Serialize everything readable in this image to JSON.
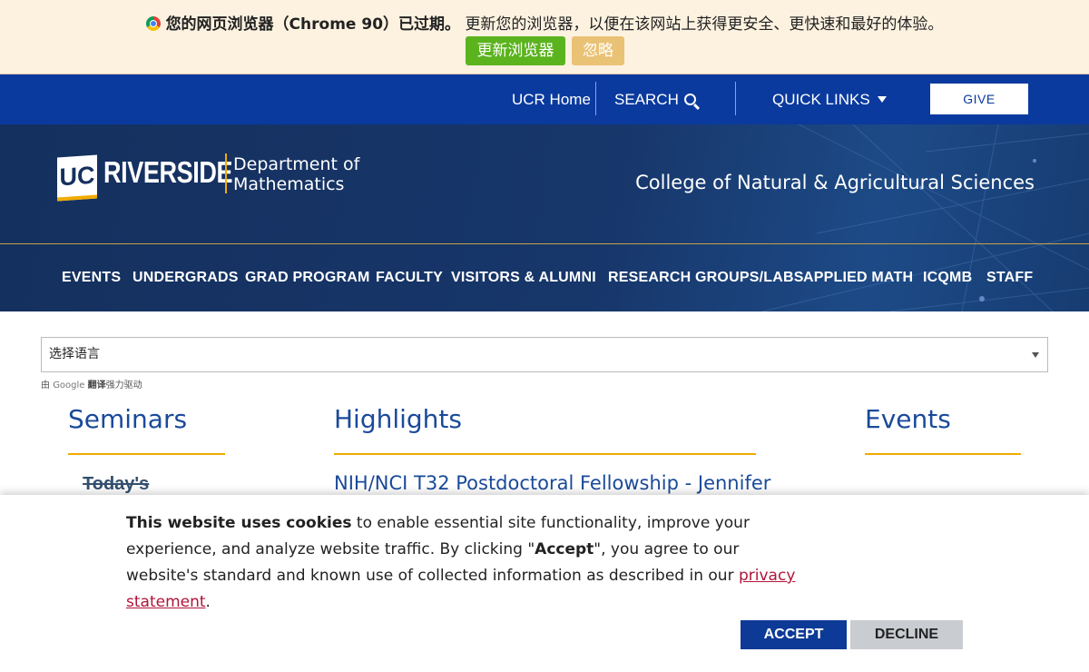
{
  "update_banner": {
    "icon": "chrome-icon",
    "bold_text": "您的网页浏览器（Chrome 90）已过期。",
    "text": "更新您的浏览器，以便在该网站上获得更安全、更快速和最好的体验。",
    "update_label": "更新浏览器",
    "ignore_label": "忽略",
    "colors": {
      "background": "#fdf2e0",
      "update": "#5bb31e",
      "ignore": "#eac275"
    }
  },
  "utility_nav": {
    "home_label": "UCR Home",
    "search_label": "SEARCH",
    "quick_links_label": "QUICK LINKS",
    "give_label": "GIVE",
    "background": "#0a3a9e"
  },
  "brand": {
    "logo_uc": "UC",
    "logo_name": "RIVERSIDE",
    "dept_line1": "Department of",
    "dept_line2": "Mathematics",
    "college": "College of Natural & Agricultural Sciences",
    "accent": "#f1ab00"
  },
  "main_nav": {
    "items": [
      "EVENTS",
      "UNDERGRADS",
      "GRAD PROGRAM",
      "FACULTY",
      "VISITORS & ALUMNI",
      "RESEARCH GROUPS/LABS",
      "APPLIED MATH",
      "ICQMB",
      "STAFF"
    ]
  },
  "translate": {
    "select_value": "选择语言",
    "credit_prefix": "由",
    "credit_google": "Google",
    "credit_translate": "翻译",
    "credit_suffix": "强力驱动"
  },
  "columns": {
    "seminars_title": "Seminars",
    "seminar_today": "Today's",
    "highlights_title": "Highlights",
    "highlight_link": "NIH/NCI T32 Postdoctoral Fellowship - Jennifer",
    "events_title": "Events"
  },
  "cookie": {
    "bold_intro": "This website uses cookies",
    "text1": " to enable essential site functionality, improve your experience, and analyze website traffic. By clicking \"",
    "accept_word": "Accept",
    "text2": "\", you agree to our website's standard and known use of collected information as described in our ",
    "privacy_link": "privacy statement",
    "text3": ".",
    "accept_label": "ACCEPT",
    "decline_label": "DECLINE"
  }
}
